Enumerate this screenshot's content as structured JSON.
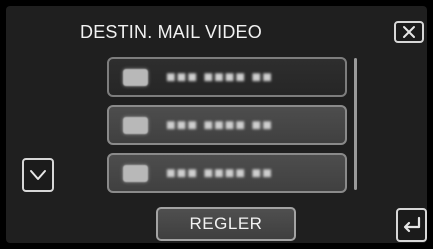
{
  "header": {
    "title": "DESTIN. MAIL VIDEO",
    "close_icon": "close-icon"
  },
  "list": {
    "items": [
      {
        "label": "■■■ ■■■■ ■■",
        "state": "selected",
        "thumbnail_icon": "thumbnail-icon"
      },
      {
        "label": "■■■ ■■■■ ■■",
        "state": "normal",
        "thumbnail_icon": "thumbnail-icon"
      },
      {
        "label": "■■■ ■■■■ ■■",
        "state": "normal",
        "thumbnail_icon": "thumbnail-icon"
      }
    ],
    "scroll_down_icon": "chevron-down-icon"
  },
  "footer": {
    "action_label": "REGLER",
    "back_icon": "return-arrow-icon"
  },
  "colors": {
    "background": "#000000",
    "panel": "#1f1f1f",
    "text": "#f2f2f2",
    "button_border": "#d7d7d7"
  }
}
